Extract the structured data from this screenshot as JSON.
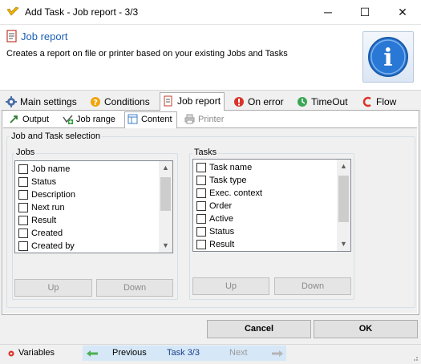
{
  "window": {
    "title": "Add Task - Job report - 3/3",
    "minimize_glyph": "─",
    "maximize_glyph": "☐",
    "close_glyph": "✕"
  },
  "header": {
    "title": "Job report",
    "description": "Creates a report on file or printer based on your existing Jobs and Tasks",
    "info_glyph": "i"
  },
  "main_tabs": [
    {
      "label": "Main settings",
      "icon": "gear-icon"
    },
    {
      "label": "Conditions",
      "icon": "conditions-icon"
    },
    {
      "label": "Job report",
      "icon": "report-icon"
    },
    {
      "label": "On error",
      "icon": "error-icon"
    },
    {
      "label": "TimeOut",
      "icon": "timeout-icon"
    },
    {
      "label": "Flow",
      "icon": "flow-icon"
    }
  ],
  "sub_tabs": [
    {
      "label": "Output",
      "icon": "output-icon"
    },
    {
      "label": "Job range",
      "icon": "job-range-icon"
    },
    {
      "label": "Content",
      "icon": "content-icon"
    },
    {
      "label": "Printer",
      "icon": "printer-icon"
    }
  ],
  "selection": {
    "group_label": "Job and Task selection",
    "jobs": {
      "label": "Jobs",
      "items": [
        "Job name",
        "Status",
        "Description",
        "Next run",
        "Result",
        "Created",
        "Created by"
      ],
      "up_label": "Up",
      "down_label": "Down"
    },
    "tasks": {
      "label": "Tasks",
      "items": [
        "Task name",
        "Task type",
        "Exec. context",
        "Order",
        "Active",
        "Status",
        "Result"
      ],
      "up_label": "Up",
      "down_label": "Down"
    }
  },
  "buttons": {
    "cancel": "Cancel",
    "ok": "OK"
  },
  "statusbar": {
    "variables": "Variables",
    "previous": "Previous",
    "task_counter": "Task 3/3",
    "next": "Next"
  },
  "colors": {
    "accent": "#1a5fb4",
    "nav_bar": "#d6e8f7"
  }
}
